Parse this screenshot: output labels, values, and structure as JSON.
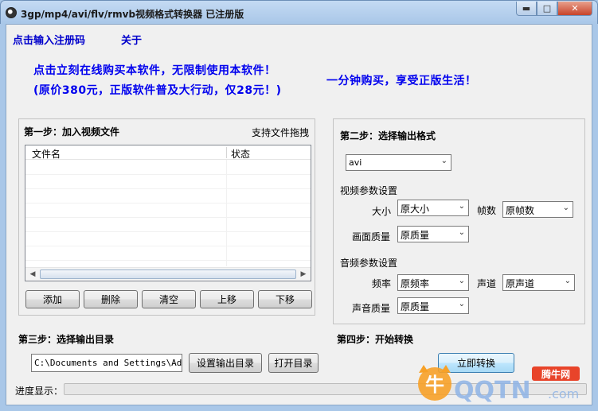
{
  "window": {
    "title": "3gp/mp4/avi/flv/rmvb视频格式转换器  已注册版",
    "minimize_glyph": "▬",
    "maximize_glyph": "□",
    "close_glyph": "✕"
  },
  "menu": {
    "register": "点击输入注册码",
    "about": "关于"
  },
  "promo": {
    "line1": "点击立刻在线购买本软件，无限制使用本软件！",
    "line2": "(原价380元，正版软件普及大行动，仅28元！)",
    "right": "一分钟购买，享受正版生活！"
  },
  "step1": {
    "title": "第一步：加入视频文件",
    "drag_hint": "支持文件拖拽",
    "columns": [
      "文件名",
      "状态"
    ],
    "buttons": {
      "add": "添加",
      "delete": "删除",
      "clear": "清空",
      "up": "上移",
      "down": "下移"
    }
  },
  "step2": {
    "title": "第二步：选择输出格式",
    "format": "avi",
    "video_section": "视频参数设置",
    "size_label": "大小",
    "size_value": "原大小",
    "fps_label": "帧数",
    "fps_value": "原帧数",
    "quality_label": "画面质量",
    "quality_value": "原质量",
    "audio_section": "音频参数设置",
    "samplerate_label": "频率",
    "samplerate_value": "原频率",
    "channel_label": "声道",
    "channel_value": "原声道",
    "audio_quality_label": "声音质量",
    "audio_quality_value": "原质量"
  },
  "step3": {
    "title": "第三步：选择输出目录",
    "path": "C:\\Documents and Settings\\Admin",
    "set_dir": "设置输出目录",
    "open_dir": "打开目录"
  },
  "step4": {
    "title": "第四步：开始转换",
    "convert": "立即转换"
  },
  "progress": {
    "label": "进度显示：",
    "value": 0
  },
  "watermark": {
    "brand": "QQTN",
    "domain": ".com",
    "tag": "腾牛网"
  }
}
